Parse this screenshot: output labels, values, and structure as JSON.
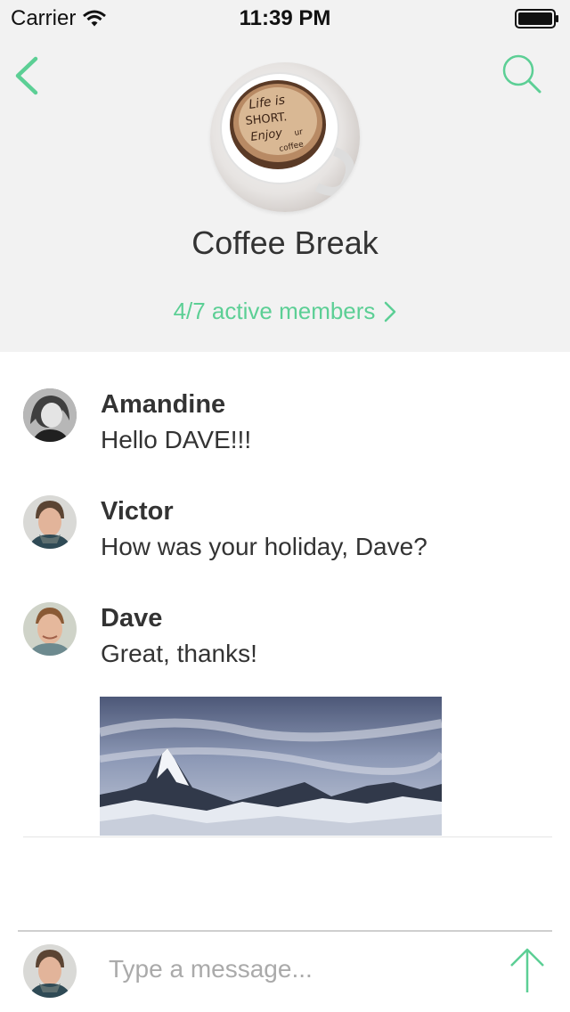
{
  "status_bar": {
    "carrier": "Carrier",
    "time": "11:39 PM",
    "icons": [
      "wifi-icon",
      "battery-icon"
    ]
  },
  "nav": {
    "back_icon": "chevron-left-icon",
    "search_icon": "search-icon"
  },
  "group": {
    "name": "Coffee Break",
    "avatar_lettering": "Life is SHORT. Enjoy ur coffee",
    "members_link": "4/7 active members",
    "members_icon": "chevron-right-icon"
  },
  "messages": [
    {
      "sender": "Amandine",
      "text": "Hello DAVE!!!"
    },
    {
      "sender": "Victor",
      "text": "How was your holiday, Dave?"
    },
    {
      "sender": "Dave",
      "text": "Great, thanks!"
    }
  ],
  "composer": {
    "placeholder": "Type a message...",
    "send_icon": "arrow-up-icon"
  },
  "colors": {
    "accent": "#5ccf95",
    "header_bg": "#f2f2f2",
    "text": "#333333",
    "placeholder": "#aaaaaa"
  }
}
